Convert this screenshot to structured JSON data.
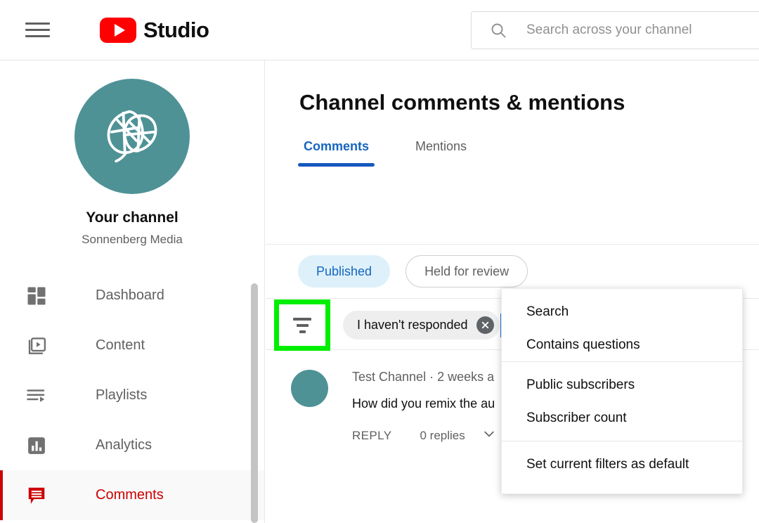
{
  "header": {
    "menu_icon": "hamburger-icon",
    "logo_icon": "youtube-play-icon",
    "brand": "Studio",
    "search": {
      "icon": "search-icon",
      "placeholder": "Search across your channel",
      "value": ""
    }
  },
  "sidebar": {
    "avatar_icon": "leaf-logo-icon",
    "avatar_color": "#4e9296",
    "your_channel": "Your channel",
    "channel_name": "Sonnenberg Media",
    "items": [
      {
        "label": "Dashboard",
        "icon": "dashboard-icon",
        "active": false
      },
      {
        "label": "Content",
        "icon": "content-video-icon",
        "active": false
      },
      {
        "label": "Playlists",
        "icon": "playlists-icon",
        "active": false
      },
      {
        "label": "Analytics",
        "icon": "analytics-bar-icon",
        "active": false
      },
      {
        "label": "Comments",
        "icon": "comments-bubble-icon",
        "active": true
      }
    ],
    "active_color": "#cc0000"
  },
  "main": {
    "title": "Channel comments & mentions",
    "tabs": [
      {
        "label": "Comments",
        "active": true
      },
      {
        "label": "Mentions",
        "active": false
      }
    ],
    "tab_accent": "#1558c0",
    "chips": [
      {
        "label": "Published",
        "selected": true
      },
      {
        "label": "Held for review",
        "selected": false
      }
    ],
    "filter": {
      "icon": "filter-icon",
      "highlight_color": "#00ee00",
      "token": {
        "label": "I haven't responded",
        "remove_icon": "close-circle-icon"
      },
      "caret_color": "#1a73e8"
    },
    "comment": {
      "avatar_color": "#4e9296",
      "author": "Test Channel",
      "separator": "·",
      "timestamp": "2 weeks a",
      "text": "How did you remix the au",
      "reply_label": "REPLY",
      "replies_label": "0 replies",
      "replies_chevron": "chevron-down-icon"
    }
  },
  "menu": {
    "groups": [
      {
        "items": [
          "Search",
          "Contains questions"
        ]
      },
      {
        "items": [
          "Public subscribers",
          "Subscriber count"
        ]
      },
      {
        "items": [
          "Set current filters as default"
        ]
      }
    ]
  }
}
